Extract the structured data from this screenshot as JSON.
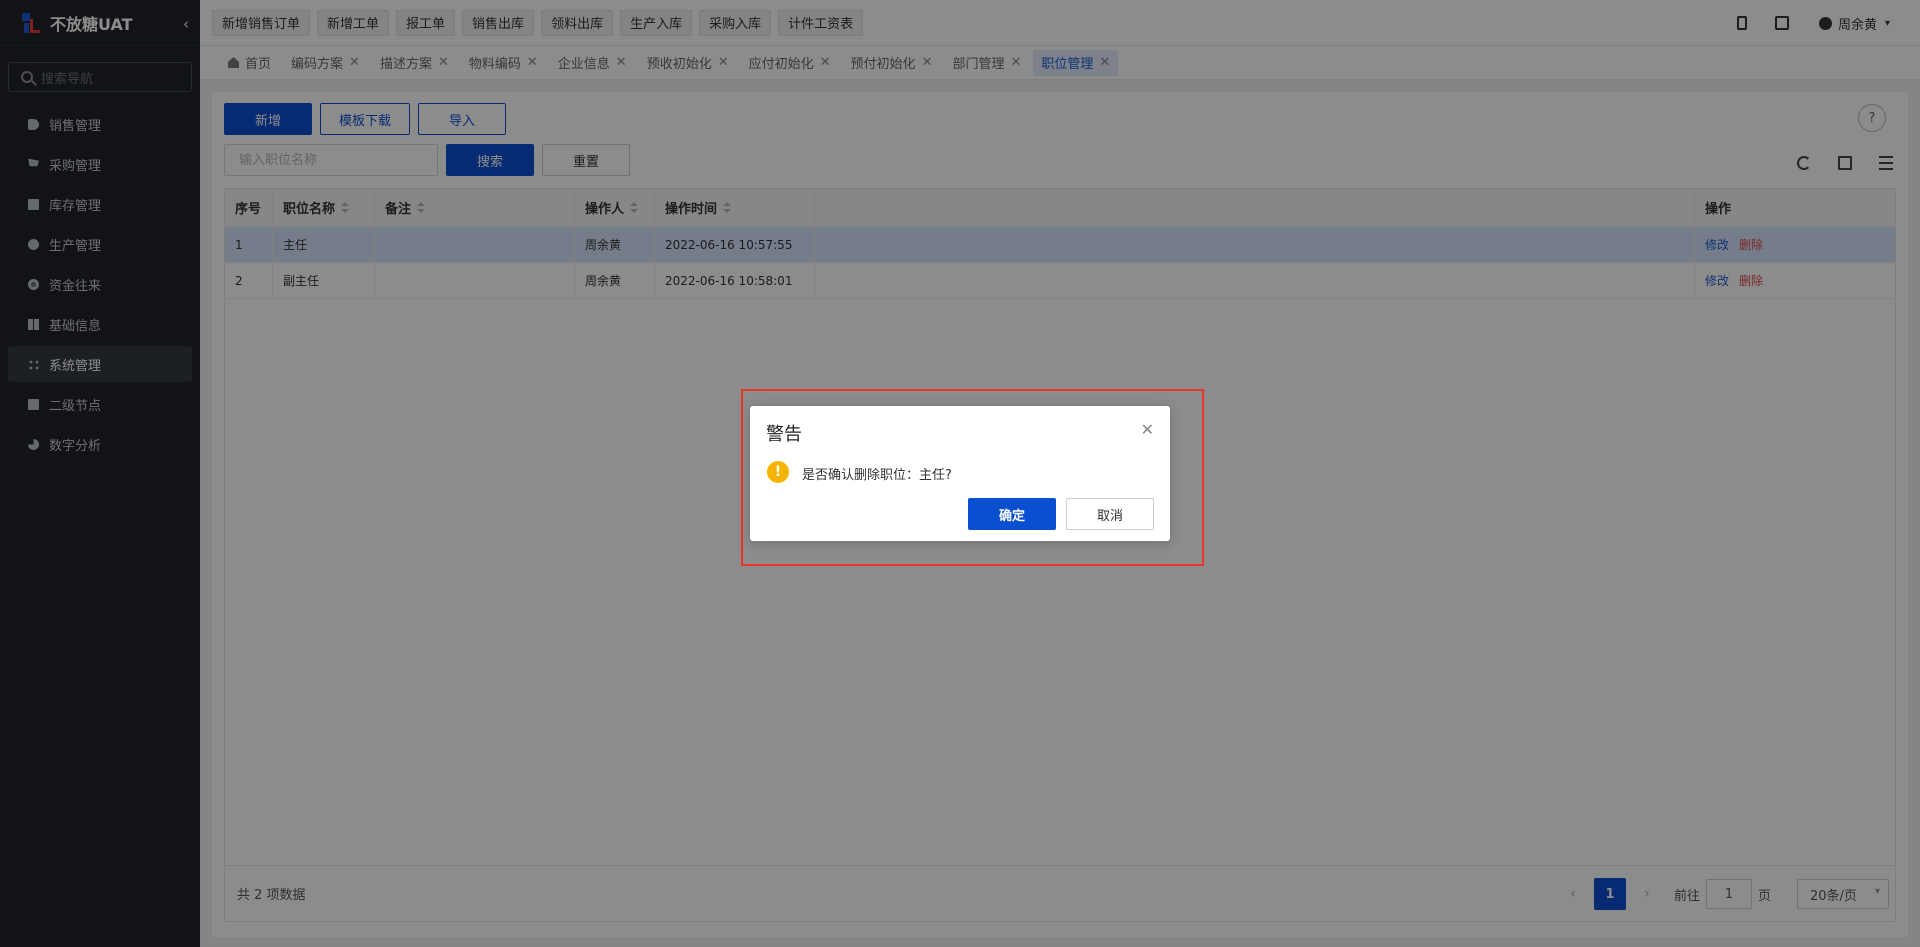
{
  "app": {
    "brand": "不放糖UAT"
  },
  "sidebar": {
    "search_placeholder": "搜索导航",
    "items": [
      {
        "label": "销售管理",
        "icon": "tag-icon"
      },
      {
        "label": "采购管理",
        "icon": "cart-icon"
      },
      {
        "label": "库存管理",
        "icon": "box-icon"
      },
      {
        "label": "生产管理",
        "icon": "nodes-icon"
      },
      {
        "label": "资金往来",
        "icon": "coin-icon"
      },
      {
        "label": "基础信息",
        "icon": "grid-icon"
      },
      {
        "label": "系统管理",
        "icon": "system-icon",
        "active": true
      },
      {
        "label": "二级节点",
        "icon": "document-icon"
      },
      {
        "label": "数字分析",
        "icon": "pie-chart-icon"
      }
    ]
  },
  "topbar": {
    "quick_actions": [
      "新增销售订单",
      "新增工单",
      "报工单",
      "销售出库",
      "领料出库",
      "生产入库",
      "采购入库",
      "计件工资表"
    ],
    "user_name": "周余黄"
  },
  "tabs": [
    {
      "label": "首页"
    },
    {
      "label": "编码方案"
    },
    {
      "label": "描述方案"
    },
    {
      "label": "物料编码"
    },
    {
      "label": "企业信息"
    },
    {
      "label": "预收初始化"
    },
    {
      "label": "应付初始化"
    },
    {
      "label": "预付初始化"
    },
    {
      "label": "部门管理"
    },
    {
      "label": "职位管理",
      "active": true
    }
  ],
  "toolbar": {
    "add_label": "新增",
    "template_download_label": "模板下载",
    "import_label": "导入",
    "search_placeholder": "输入职位名称",
    "search_label": "搜索",
    "reset_label": "重置"
  },
  "table": {
    "headers": [
      "序号",
      "职位名称",
      "备注",
      "操作人",
      "操作时间",
      "",
      "操作"
    ],
    "rows": [
      {
        "index": "1",
        "name": "主任",
        "note": "",
        "operator": "周余黄",
        "time": "2022-06-16 10:57:55",
        "edit": "修改",
        "delete": "删除"
      },
      {
        "index": "2",
        "name": "副主任",
        "note": "",
        "operator": "周余黄",
        "time": "2022-06-16 10:58:01",
        "edit": "修改",
        "delete": "删除"
      }
    ],
    "total_text": "共 2 项数据"
  },
  "pagination": {
    "current_page": "1",
    "goto_label": "前往",
    "goto_value": "1",
    "page_suffix": "页",
    "page_size": "20条/页"
  },
  "dialog": {
    "title": "警告",
    "message": "是否确认删除职位：主任?",
    "confirm_label": "确定",
    "cancel_label": "取消"
  },
  "colors": {
    "primary": "#0b4fd1",
    "danger": "#e04848",
    "warning": "#f4b400",
    "highlight": "#e8352b"
  }
}
